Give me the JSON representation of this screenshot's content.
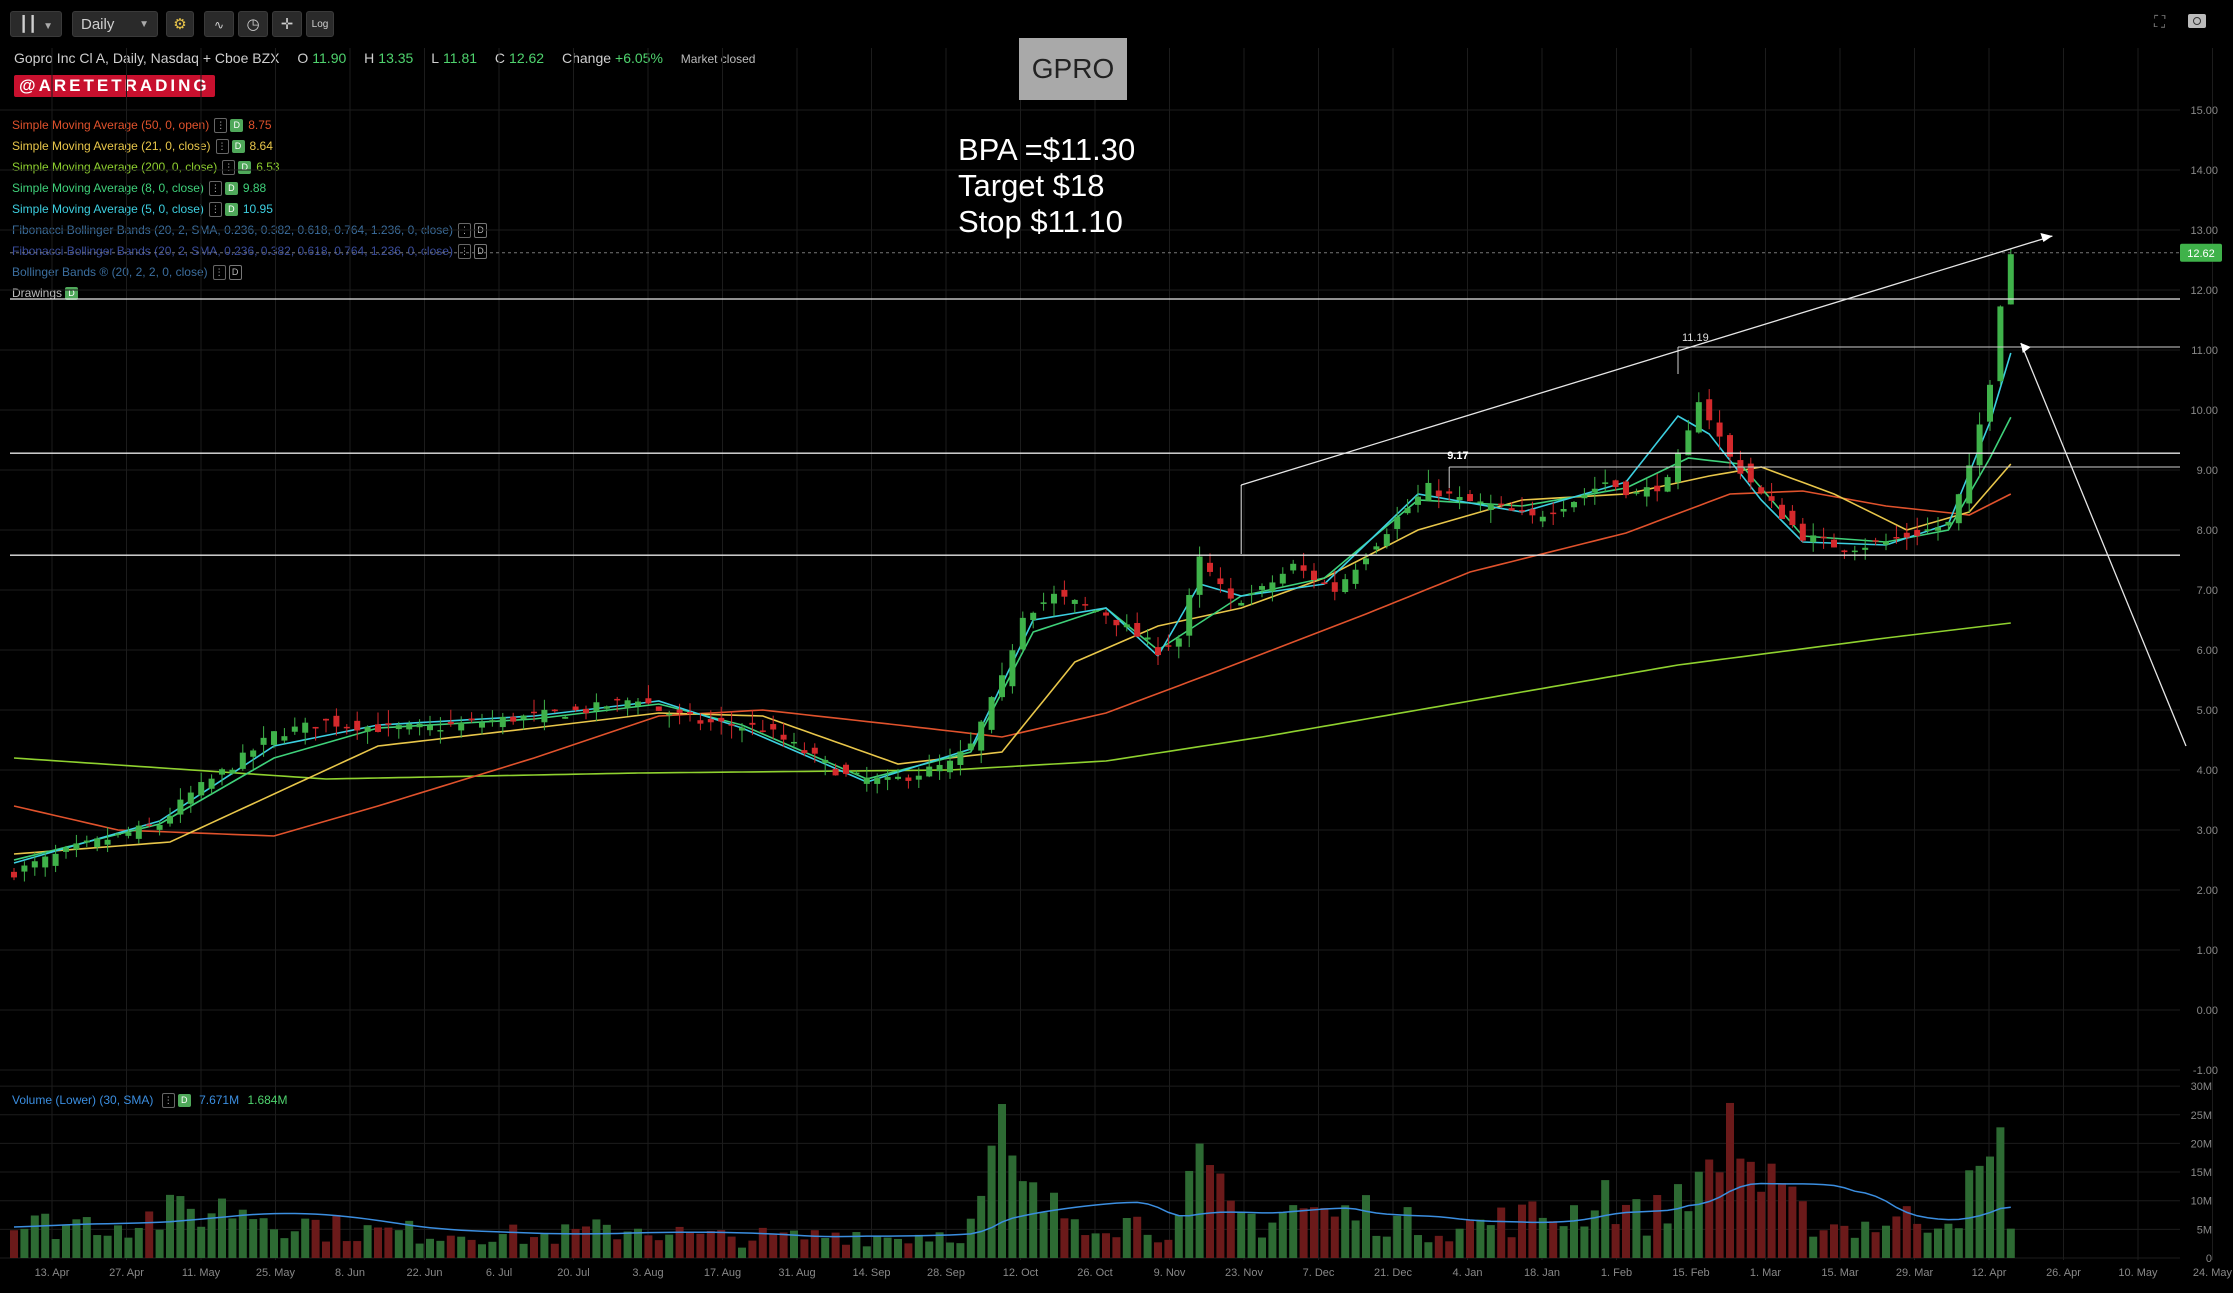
{
  "toolbar": {
    "chart_style_icon": "candlestick-icon",
    "interval": "Daily",
    "settings_icon": "gear-icon",
    "log_label": "Log",
    "fullscreen_icon": "fullscreen-icon",
    "camera_icon": "camera-icon"
  },
  "header": {
    "symbol_desc": "Gopro Inc Cl A, Daily, Nasdaq + Cboe BZX",
    "open_label": "O",
    "open": "11.90",
    "high_label": "H",
    "high": "13.35",
    "low_label": "L",
    "low": "11.81",
    "close_label": "C",
    "close": "12.62",
    "change_label": "Change",
    "change": "+6.05%",
    "market_status": "Market closed",
    "watermark": "@ARETETRADING"
  },
  "annotations": {
    "ticker": "GPRO",
    "bpa": "BPA =$11.30",
    "target": "Target $18",
    "stop": "Stop $11.10",
    "label_1119": "11.19",
    "label_917": "9.17"
  },
  "legends": [
    {
      "text": "Simple Moving Average (50, 0, open)",
      "value": "8.75",
      "color": "#e0522c"
    },
    {
      "text": "Simple Moving Average (21, 0, close)",
      "value": "8.64",
      "color": "#e8c64a"
    },
    {
      "text": "Simple Moving Average (200, 0, close)",
      "value": "6.53",
      "color": "#8fd12f"
    },
    {
      "text": "Simple Moving Average (8, 0, close)",
      "value": "9.88",
      "color": "#3fd17a"
    },
    {
      "text": "Simple Moving Average (5, 0, close)",
      "value": "10.95",
      "color": "#3ccfe0"
    },
    {
      "text": "Fibonacci Bollinger Bands (20, 2, SMA, 0.236, 0.382, 0.618, 0.764, 1.236, 0, close)",
      "value": "",
      "color": "#3b6e9e"
    },
    {
      "text": "Fibonacci Bollinger Bands (20, 2, SMA, 0.236, 0.382, 0.618, 0.764, 1.236, 0, close)",
      "value": "",
      "color": "#3b4e9e"
    },
    {
      "text": "Bollinger Bands ® (20, 2, 2, 0, close)",
      "value": "",
      "color": "#3b6e9e"
    },
    {
      "text": "Drawings",
      "value": "",
      "color": "#bbbbbb"
    }
  ],
  "volume_legend": {
    "text": "Volume (Lower) (30, SMA)",
    "value1": "7.671M",
    "value2": "1.684M",
    "color": "#3b8ee0"
  },
  "chart_data": {
    "type": "candlestick",
    "ylim": [
      -1,
      15.5
    ],
    "price_ticks": [
      "15.00",
      "14.00",
      "13.00",
      "12.00",
      "11.00",
      "10.00",
      "9.00",
      "8.00",
      "7.00",
      "6.00",
      "5.00",
      "4.00",
      "3.00",
      "2.00",
      "1.00",
      "0.00",
      "-1.00"
    ],
    "last_price": "12.62",
    "volume_ticks": [
      "30M",
      "25M",
      "20M",
      "15M",
      "10M",
      "5M",
      "0"
    ],
    "x_dates": [
      "13. Apr",
      "27. Apr",
      "11. May",
      "25. May",
      "8. Jun",
      "22. Jun",
      "6. Jul",
      "20. Jul",
      "3. Aug",
      "17. Aug",
      "31. Aug",
      "14. Sep",
      "28. Sep",
      "12. Oct",
      "26. Oct",
      "9. Nov",
      "23. Nov",
      "7. Dec",
      "21. Dec",
      "4. Jan",
      "18. Jan",
      "1. Feb",
      "15. Feb",
      "1. Mar",
      "15. Mar",
      "29. Mar",
      "12. Apr",
      "26. Apr",
      "10. May",
      "24. May"
    ],
    "horizontal_levels": [
      11.85,
      9.28,
      7.58
    ],
    "close_path": [
      [
        0,
        2.3
      ],
      [
        6,
        2.7
      ],
      [
        10,
        2.9
      ],
      [
        14,
        3.1
      ],
      [
        17,
        3.6
      ],
      [
        22,
        4.2
      ],
      [
        25,
        4.6
      ],
      [
        30,
        4.8
      ],
      [
        35,
        4.7
      ],
      [
        40,
        4.7
      ],
      [
        45,
        4.8
      ],
      [
        50,
        4.9
      ],
      [
        55,
        5.0
      ],
      [
        60,
        5.2
      ],
      [
        62,
        5.0
      ],
      [
        66,
        4.8
      ],
      [
        72,
        4.7
      ],
      [
        76,
        4.3
      ],
      [
        80,
        3.9
      ],
      [
        84,
        3.8
      ],
      [
        90,
        4.1
      ],
      [
        92,
        4.4
      ],
      [
        95,
        5.5
      ],
      [
        97,
        6.6
      ],
      [
        100,
        6.9
      ],
      [
        105,
        6.6
      ],
      [
        110,
        6.0
      ],
      [
        112,
        6.2
      ],
      [
        114,
        7.5
      ],
      [
        117,
        6.8
      ],
      [
        120,
        7.0
      ],
      [
        123,
        7.4
      ],
      [
        127,
        7.0
      ],
      [
        130,
        7.6
      ],
      [
        133,
        8.2
      ],
      [
        136,
        8.7
      ],
      [
        139,
        8.5
      ],
      [
        142,
        8.4
      ],
      [
        146,
        8.2
      ],
      [
        150,
        8.5
      ],
      [
        153,
        8.8
      ],
      [
        156,
        8.6
      ],
      [
        159,
        8.8
      ],
      [
        161,
        9.6
      ],
      [
        162,
        10.2
      ],
      [
        165,
        9.2
      ],
      [
        168,
        8.6
      ],
      [
        172,
        7.9
      ],
      [
        176,
        7.7
      ],
      [
        180,
        7.8
      ],
      [
        184,
        8.0
      ],
      [
        186,
        8.1
      ],
      [
        188,
        9.0
      ],
      [
        190,
        10.5
      ],
      [
        191,
        11.8
      ],
      [
        192,
        12.62
      ]
    ],
    "volume_path": [
      [
        0,
        6
      ],
      [
        6,
        7
      ],
      [
        10,
        7
      ],
      [
        14,
        8
      ],
      [
        17,
        9
      ],
      [
        22,
        10
      ],
      [
        25,
        8
      ],
      [
        30,
        6
      ],
      [
        35,
        5
      ],
      [
        40,
        5
      ],
      [
        45,
        5
      ],
      [
        50,
        4
      ],
      [
        55,
        5
      ],
      [
        60,
        6
      ],
      [
        66,
        4
      ],
      [
        72,
        4
      ],
      [
        76,
        4
      ],
      [
        80,
        5
      ],
      [
        84,
        4
      ],
      [
        90,
        5
      ],
      [
        92,
        6
      ],
      [
        95,
        22
      ],
      [
        97,
        12
      ],
      [
        100,
        9
      ],
      [
        105,
        8
      ],
      [
        110,
        6
      ],
      [
        112,
        7
      ],
      [
        114,
        16
      ],
      [
        117,
        9
      ],
      [
        120,
        7
      ],
      [
        123,
        10
      ],
      [
        127,
        8
      ],
      [
        130,
        9
      ],
      [
        133,
        7
      ],
      [
        136,
        6
      ],
      [
        139,
        6
      ],
      [
        142,
        7
      ],
      [
        146,
        8
      ],
      [
        150,
        9
      ],
      [
        153,
        13
      ],
      [
        156,
        8
      ],
      [
        159,
        9
      ],
      [
        161,
        17
      ],
      [
        162,
        12
      ],
      [
        165,
        27
      ],
      [
        168,
        14
      ],
      [
        172,
        8
      ],
      [
        176,
        6
      ],
      [
        180,
        7
      ],
      [
        184,
        8
      ],
      [
        186,
        9
      ],
      [
        188,
        12
      ],
      [
        190,
        17
      ],
      [
        191,
        19
      ],
      [
        192,
        10
      ]
    ],
    "sma200_path": [
      [
        0,
        4.2
      ],
      [
        30,
        3.85
      ],
      [
        60,
        3.95
      ],
      [
        90,
        4.0
      ],
      [
        105,
        4.15
      ],
      [
        120,
        4.55
      ],
      [
        140,
        5.15
      ],
      [
        160,
        5.75
      ],
      [
        180,
        6.2
      ],
      [
        192,
        6.45
      ]
    ],
    "sma50_path": [
      [
        0,
        3.4
      ],
      [
        10,
        3.0
      ],
      [
        25,
        2.9
      ],
      [
        35,
        3.4
      ],
      [
        50,
        4.2
      ],
      [
        62,
        4.9
      ],
      [
        72,
        5.0
      ],
      [
        85,
        4.75
      ],
      [
        95,
        4.55
      ],
      [
        105,
        4.95
      ],
      [
        115,
        5.6
      ],
      [
        130,
        6.6
      ],
      [
        140,
        7.3
      ],
      [
        155,
        7.95
      ],
      [
        165,
        8.6
      ],
      [
        172,
        8.65
      ],
      [
        180,
        8.4
      ],
      [
        188,
        8.25
      ],
      [
        192,
        8.6
      ]
    ],
    "sma21_path": [
      [
        0,
        2.6
      ],
      [
        15,
        2.8
      ],
      [
        25,
        3.6
      ],
      [
        35,
        4.4
      ],
      [
        50,
        4.7
      ],
      [
        62,
        4.95
      ],
      [
        72,
        4.9
      ],
      [
        85,
        4.1
      ],
      [
        95,
        4.3
      ],
      [
        102,
        5.8
      ],
      [
        110,
        6.4
      ],
      [
        118,
        6.7
      ],
      [
        126,
        7.2
      ],
      [
        135,
        8.0
      ],
      [
        145,
        8.5
      ],
      [
        155,
        8.6
      ],
      [
        163,
        8.9
      ],
      [
        168,
        9.05
      ],
      [
        175,
        8.6
      ],
      [
        182,
        8.0
      ],
      [
        188,
        8.3
      ],
      [
        192,
        9.1
      ]
    ],
    "sma8_path": [
      [
        0,
        2.5
      ],
      [
        14,
        3.1
      ],
      [
        25,
        4.2
      ],
      [
        35,
        4.7
      ],
      [
        50,
        4.85
      ],
      [
        62,
        5.1
      ],
      [
        70,
        4.75
      ],
      [
        82,
        3.85
      ],
      [
        92,
        4.3
      ],
      [
        98,
        6.3
      ],
      [
        105,
        6.7
      ],
      [
        110,
        6.0
      ],
      [
        118,
        6.9
      ],
      [
        126,
        7.2
      ],
      [
        135,
        8.5
      ],
      [
        145,
        8.4
      ],
      [
        155,
        8.7
      ],
      [
        161,
        9.2
      ],
      [
        166,
        9.1
      ],
      [
        172,
        7.9
      ],
      [
        180,
        7.8
      ],
      [
        186,
        8.0
      ],
      [
        190,
        9.2
      ],
      [
        192,
        9.88
      ]
    ],
    "sma5_path": [
      [
        0,
        2.45
      ],
      [
        14,
        3.15
      ],
      [
        25,
        4.4
      ],
      [
        35,
        4.75
      ],
      [
        50,
        4.9
      ],
      [
        62,
        5.15
      ],
      [
        70,
        4.7
      ],
      [
        82,
        3.8
      ],
      [
        92,
        4.35
      ],
      [
        98,
        6.5
      ],
      [
        105,
        6.7
      ],
      [
        110,
        5.9
      ],
      [
        114,
        7.1
      ],
      [
        118,
        6.9
      ],
      [
        126,
        7.1
      ],
      [
        135,
        8.6
      ],
      [
        145,
        8.3
      ],
      [
        155,
        8.8
      ],
      [
        160,
        9.9
      ],
      [
        163,
        9.6
      ],
      [
        168,
        8.5
      ],
      [
        172,
        7.8
      ],
      [
        180,
        7.75
      ],
      [
        186,
        8.1
      ],
      [
        190,
        9.8
      ],
      [
        192,
        10.95
      ]
    ],
    "trendline": {
      "from": [
        118,
        8.75
      ],
      "to": [
        196,
        12.9
      ]
    },
    "projection": {
      "from": [
        192,
        11.05
      ],
      "to": [
        205,
        4.4
      ]
    }
  }
}
